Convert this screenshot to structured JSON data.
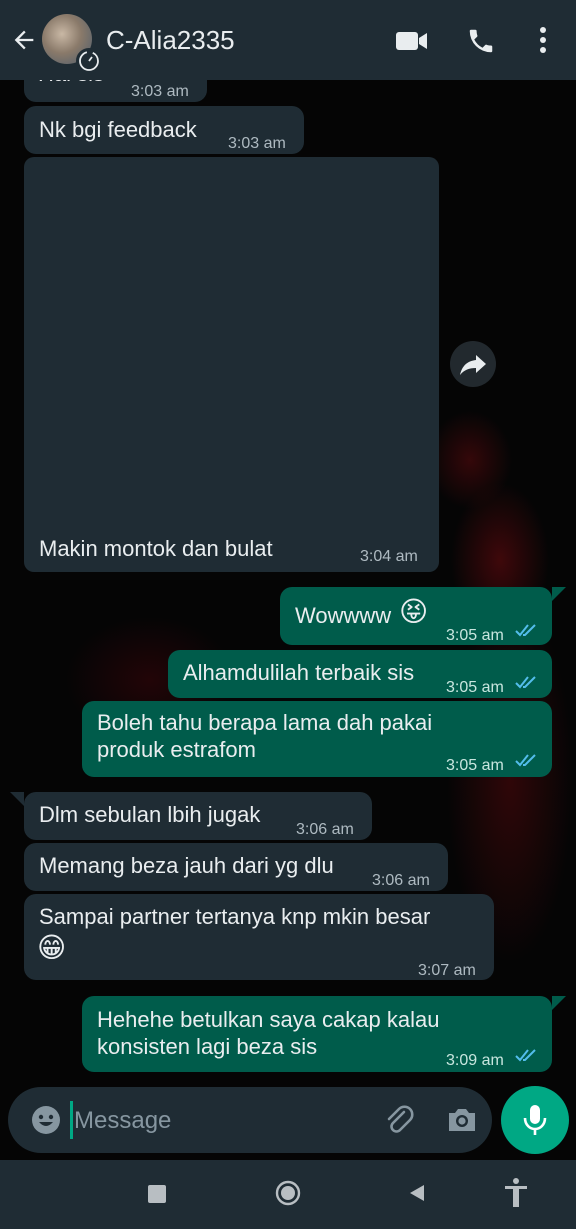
{
  "header": {
    "contact_name": "C-Alia2335",
    "icons": [
      "back-arrow-icon",
      "avatar",
      "disappearing-timer-icon",
      "video-call-icon",
      "voice-call-icon",
      "more-options-icon"
    ]
  },
  "messages": [
    {
      "id": "m0",
      "direction": "incoming",
      "text": "Hai sis",
      "time": "3:03 am"
    },
    {
      "id": "m1",
      "direction": "incoming",
      "text": "Nk bgi feedback",
      "time": "3:03 am"
    },
    {
      "id": "m2",
      "direction": "incoming",
      "type": "image",
      "caption": "Makin montok dan bulat",
      "time": "3:04 am"
    },
    {
      "id": "m3",
      "direction": "outgoing",
      "text": "Wowwww",
      "emoji": "😝",
      "time": "3:05 am",
      "status": "read"
    },
    {
      "id": "m4",
      "direction": "outgoing",
      "text": "Alhamdulilah terbaik sis",
      "time": "3:05 am",
      "status": "read"
    },
    {
      "id": "m5",
      "direction": "outgoing",
      "line1": "Boleh tahu berapa lama dah pakai",
      "line2": "produk estrafom",
      "time": "3:05 am",
      "status": "read"
    },
    {
      "id": "m6",
      "direction": "incoming",
      "text": "Dlm sebulan lbih jugak",
      "time": "3:06 am"
    },
    {
      "id": "m7",
      "direction": "incoming",
      "text": "Memang beza jauh dari yg dlu",
      "time": "3:06 am"
    },
    {
      "id": "m8",
      "direction": "incoming",
      "line1": "Sampai partner tertanya knp mkin besar",
      "emoji": "😁",
      "time": "3:07 am"
    },
    {
      "id": "m9",
      "direction": "outgoing",
      "line1": "Hehehe betulkan saya cakap kalau",
      "line2": "konsisten lagi beza sis",
      "time": "3:09 am",
      "status": "read"
    }
  ],
  "composer": {
    "placeholder": "Message"
  },
  "colors": {
    "header_bg": "#1f2c34",
    "incoming_bubble": "#1f2c34",
    "outgoing_bubble": "#005c4b",
    "accent": "#00a884",
    "read_ticks": "#53bdeb"
  }
}
